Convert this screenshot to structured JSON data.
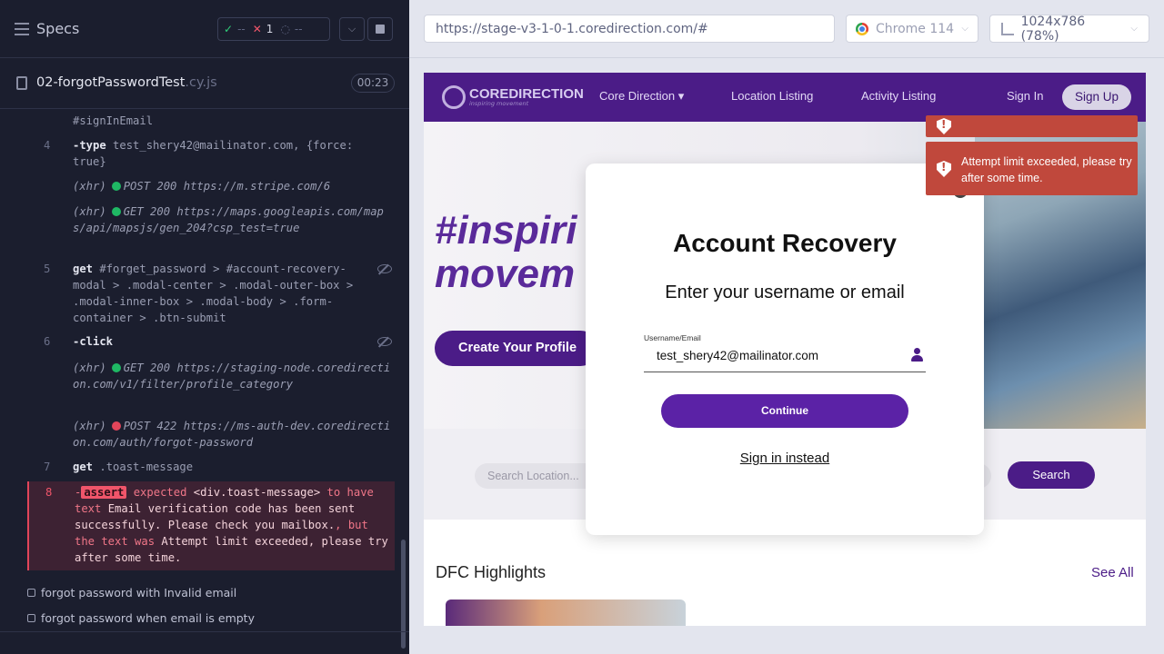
{
  "runner": {
    "title": "Specs",
    "stats": {
      "passed": "--",
      "failed": "1",
      "pending": "--"
    },
    "spec_file": {
      "name": "02-forgotPasswordTest",
      "ext": ".cy.js",
      "duration": "00:23"
    },
    "log": [
      {
        "num": "",
        "text": "#signInEmail"
      },
      {
        "num": "4",
        "cmd": "-type",
        "args": "test_shery42@mailinator.com, {force: true}"
      },
      {
        "kind": "xhr",
        "status": "POST 200",
        "url": "https://m.stripe.com/6"
      },
      {
        "kind": "xhr",
        "status": "GET 200",
        "url": "https://maps.googleapis.com/maps/api/mapsjs/gen_204?csp_test=true"
      },
      {
        "num": "5",
        "cmd": "get",
        "args": "#forget_password > #account-recovery-modal > .modal-center > .modal-outer-box > .modal-inner-box > .modal-body > .form-container > .btn-submit"
      },
      {
        "num": "6",
        "cmd": "-click",
        "args": ""
      },
      {
        "kind": "xhr",
        "status": "GET 200",
        "url": "https://staging-node.coredirection.com/v1/filter/profile_category"
      },
      {
        "kind": "xhr",
        "status": "POST 422",
        "url": "https://ms-auth-dev.coredirection.com/auth/forgot-password"
      },
      {
        "num": "7",
        "cmd": "get",
        "args": ".toast-message"
      },
      {
        "num": "8",
        "cmd": "-assert",
        "expected": "expected",
        "el": "<div.toast-message>",
        "to_have": "to have text",
        "exp_text": "Email verification code has been sent successfully. Please check you mailbox.",
        "but": ", but the text was",
        "actual": "Attempt limit exceeded, please try after some time."
      }
    ],
    "xhr_label": "(xhr)",
    "tests": [
      "forgot password with Invalid email",
      "forgot password when email is empty"
    ]
  },
  "aut": {
    "url": "https://stage-v3-1-0-1.coredirection.com/#",
    "browser": "Chrome 114",
    "viewport": "1024x786 (78%)"
  },
  "site": {
    "logo_text": "COREDIRECTION",
    "logo_sub": "inspiring movement",
    "nav": [
      "Core Direction ▾",
      "Location Listing",
      "Activity Listing",
      "Sign In"
    ],
    "signup": "Sign Up",
    "hero_title_1": "#inspiri",
    "hero_title_2": "movem",
    "create_profile": "Create Your Profile",
    "search_placeholder": "Search Location...",
    "search_btn": "Search",
    "highlights": "DFC Highlights",
    "see_all": "See All"
  },
  "modal": {
    "title": "Account Recovery",
    "subtitle": "Enter your username or email",
    "field_label": "Username/Email",
    "field_value": "test_shery42@mailinator.com",
    "continue": "Continue",
    "signin_instead": "Sign in instead"
  },
  "toast": {
    "message": "Attempt limit exceeded, please try after some time."
  },
  "colors": {
    "brand": "#4b1c87",
    "error": "#c0483c",
    "runner_bg": "#1b1e2e"
  }
}
